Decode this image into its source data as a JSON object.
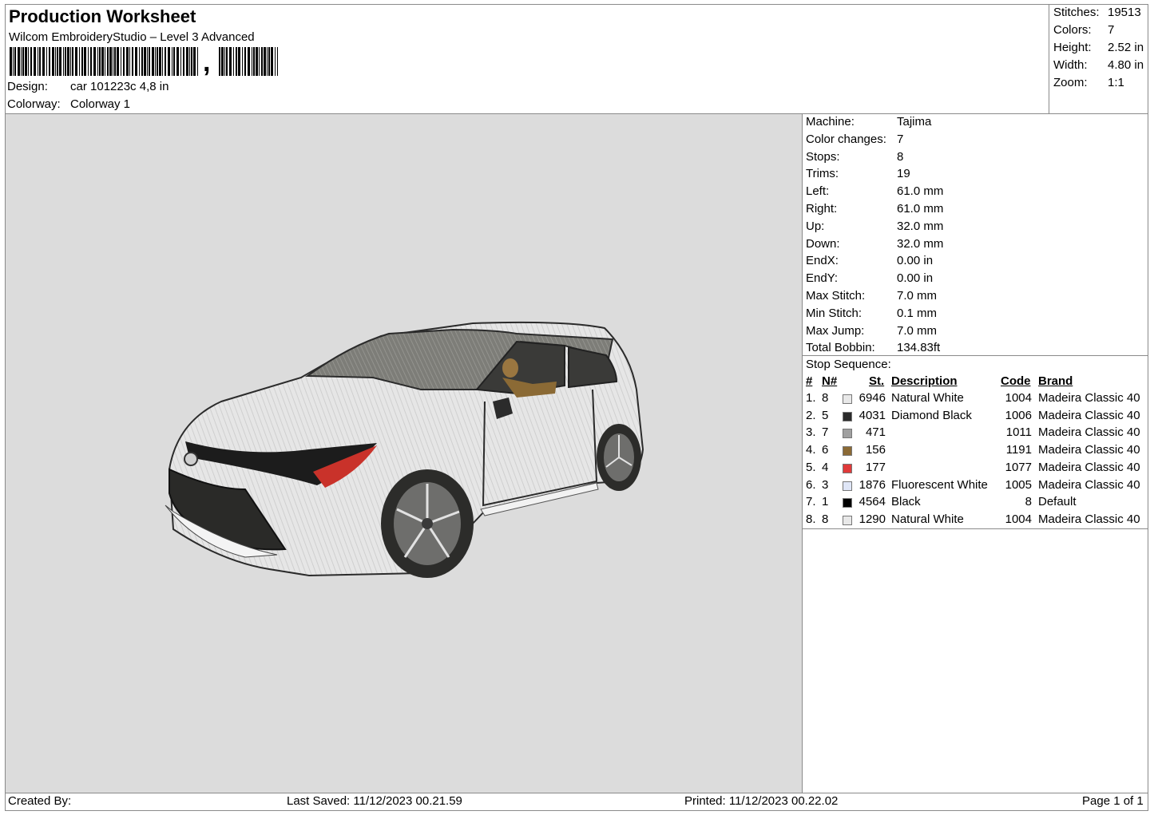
{
  "header": {
    "title": "Production Worksheet",
    "software": "Wilcom EmbroideryStudio – Level 3 Advanced",
    "barcode_suffix": ",",
    "design_label": "Design:",
    "design_value": "car 101223c 4,8 in",
    "colorway_label": "Colorway:",
    "colorway_value": "Colorway 1"
  },
  "summary": [
    {
      "label": "Stitches:",
      "value": "19513"
    },
    {
      "label": "Colors:",
      "value": "7"
    },
    {
      "label": "Height:",
      "value": "2.52 in"
    },
    {
      "label": "Width:",
      "value": "4.80 in"
    },
    {
      "label": "Zoom:",
      "value": "1:1"
    }
  ],
  "machine_info": [
    {
      "label": "Machine:",
      "value": "Tajima"
    },
    {
      "label": "Color changes:",
      "value": "7"
    },
    {
      "label": "Stops:",
      "value": "8"
    },
    {
      "label": "Trims:",
      "value": "19"
    },
    {
      "label": "Left:",
      "value": "61.0 mm"
    },
    {
      "label": "Right:",
      "value": "61.0 mm"
    },
    {
      "label": "Up:",
      "value": "32.0 mm"
    },
    {
      "label": "Down:",
      "value": "32.0 mm"
    },
    {
      "label": "EndX:",
      "value": "0.00 in"
    },
    {
      "label": "EndY:",
      "value": "0.00 in"
    },
    {
      "label": "Max Stitch:",
      "value": "7.0 mm"
    },
    {
      "label": "Min Stitch:",
      "value": "0.1 mm"
    },
    {
      "label": "Max Jump:",
      "value": "7.0 mm"
    },
    {
      "label": "Total Bobbin:",
      "value": "134.83ft"
    }
  ],
  "stop_sequence": {
    "label": "Stop Sequence:",
    "columns": {
      "num": "#",
      "n": "N#",
      "st": "St.",
      "desc": "Description",
      "code": "Code",
      "brand": "Brand"
    },
    "rows": [
      {
        "num": "1.",
        "n": "8",
        "color": "#e8e8e8",
        "st": "6946",
        "desc": "Natural White",
        "code": "1004",
        "brand": "Madeira Classic 40"
      },
      {
        "num": "2.",
        "n": "5",
        "color": "#2a2a2a",
        "st": "4031",
        "desc": "Diamond Black",
        "code": "1006",
        "brand": "Madeira Classic 40"
      },
      {
        "num": "3.",
        "n": "7",
        "color": "#a0a0a0",
        "st": "471",
        "desc": "",
        "code": "1011",
        "brand": "Madeira Classic 40"
      },
      {
        "num": "4.",
        "n": "6",
        "color": "#8b6a35",
        "st": "156",
        "desc": "",
        "code": "1191",
        "brand": "Madeira Classic 40"
      },
      {
        "num": "5.",
        "n": "4",
        "color": "#e03a3a",
        "st": "177",
        "desc": "",
        "code": "1077",
        "brand": "Madeira Classic 40"
      },
      {
        "num": "6.",
        "n": "3",
        "color": "#dfe6f7",
        "st": "1876",
        "desc": "Fluorescent White",
        "code": "1005",
        "brand": "Madeira Classic 40"
      },
      {
        "num": "7.",
        "n": "1",
        "color": "#000000",
        "st": "4564",
        "desc": "Black",
        "code": "8",
        "brand": "Default"
      },
      {
        "num": "8.",
        "n": "8",
        "color": "#e8e8e8",
        "st": "1290",
        "desc": "Natural White",
        "code": "1004",
        "brand": "Madeira Classic 40"
      }
    ]
  },
  "footer": {
    "created_by": "Created By:",
    "last_saved": "Last Saved: 11/12/2023 00.21.59",
    "printed": "Printed: 11/12/2023 00.22.02",
    "page": "Page 1 of 1"
  },
  "colors": {
    "preview_bg": "#dcdcdc",
    "border": "#8a8a8a"
  }
}
